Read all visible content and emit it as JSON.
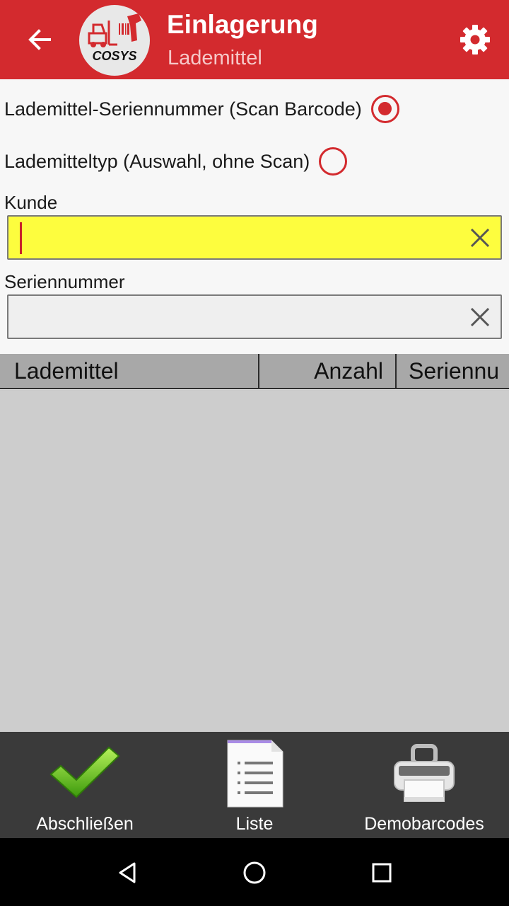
{
  "app_bar": {
    "title": "Einlagerung",
    "subtitle": "Lademittel",
    "accent_color": "#d32a2e",
    "back_icon": "arrow-left-icon",
    "settings_icon": "gear-icon",
    "logo_text": "COSYS"
  },
  "mode_options": [
    {
      "label": "Lademittel-Seriennummer (Scan Barcode)",
      "selected": true
    },
    {
      "label": "Lademitteltyp (Auswahl, ohne Scan)",
      "selected": false
    }
  ],
  "fields": {
    "kunde": {
      "label": "Kunde",
      "value": "",
      "placeholder": "",
      "focused": true,
      "background": "#fdfd3e"
    },
    "seriennummer": {
      "label": "Seriennummer",
      "value": "",
      "placeholder": "",
      "focused": false,
      "background": "#efefef"
    }
  },
  "table": {
    "columns": [
      "Lademittel",
      "Anzahl",
      "Seriennu"
    ],
    "rows": []
  },
  "actions": [
    {
      "label": "Abschließen",
      "icon": "checkmark-icon"
    },
    {
      "label": "Liste",
      "icon": "list-document-icon"
    },
    {
      "label": "Demobarcodes",
      "icon": "printer-icon"
    }
  ],
  "system_nav": {
    "back_icon": "nav-back-icon",
    "home_icon": "nav-home-icon",
    "recents_icon": "nav-recents-icon"
  }
}
